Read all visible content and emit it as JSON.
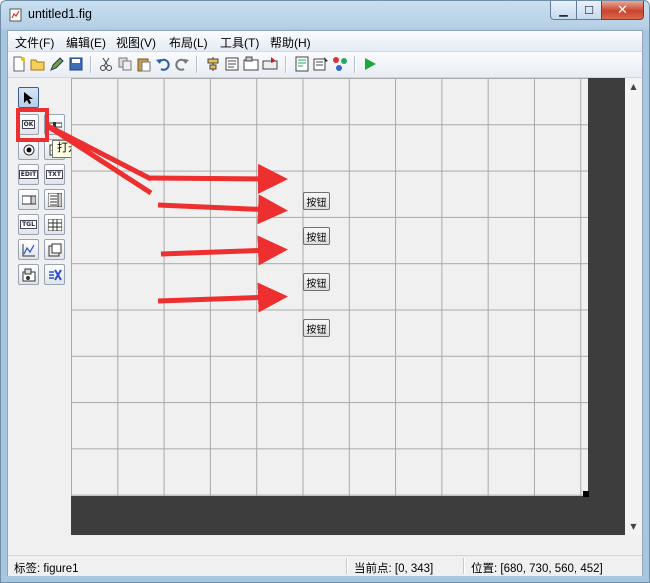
{
  "window": {
    "title": "untitled1.fig"
  },
  "menu": [
    "文件(F)",
    "编辑(E)",
    "视图(V)",
    "布局(L)",
    "工具(T)",
    "帮助(H)"
  ],
  "toolbar": {
    "icons": [
      "new-icon",
      "open-icon",
      "edit-icon",
      "save-icon",
      "cut-icon",
      "copy-icon",
      "paste-icon",
      "undo-icon",
      "redo-icon",
      "align-icon",
      "menu-editor-icon",
      "tab-order-icon",
      "toolbar-editor-icon",
      "editor-icon",
      "property-inspector-icon",
      "object-browser-icon",
      "run-icon"
    ]
  },
  "tooltip": {
    "text": "打开 (Ctrl+O)"
  },
  "palette": {
    "items": [
      {
        "name": "select-tool",
        "label": ""
      },
      {
        "name": "push-button-tool",
        "label": "OK"
      },
      {
        "name": "slider-tool",
        "label": ""
      },
      {
        "name": "radio-button-tool",
        "label": ""
      },
      {
        "name": "checkbox-tool",
        "label": ""
      },
      {
        "name": "edit-text-tool",
        "label": "EDIT"
      },
      {
        "name": "static-text-tool",
        "label": "TXT"
      },
      {
        "name": "popup-menu-tool",
        "label": ""
      },
      {
        "name": "listbox-tool",
        "label": ""
      },
      {
        "name": "toggle-button-tool",
        "label": "TGL"
      },
      {
        "name": "table-tool",
        "label": ""
      },
      {
        "name": "axes-tool",
        "label": ""
      },
      {
        "name": "panel-tool",
        "label": ""
      },
      {
        "name": "button-group-tool",
        "label": ""
      },
      {
        "name": "activex-tool",
        "label": ""
      }
    ]
  },
  "canvas": {
    "buttons": [
      {
        "label": "按钮"
      },
      {
        "label": "按钮"
      },
      {
        "label": "按钮"
      },
      {
        "label": "按钮"
      }
    ]
  },
  "status": {
    "tag": "标签: figure1",
    "current_point": "当前点:  [0, 343]",
    "position": "位置: [680, 730, 560, 452]"
  },
  "colors": {
    "annotation": "#ee2f2f",
    "canvas_dark": "#3d3d3d"
  }
}
